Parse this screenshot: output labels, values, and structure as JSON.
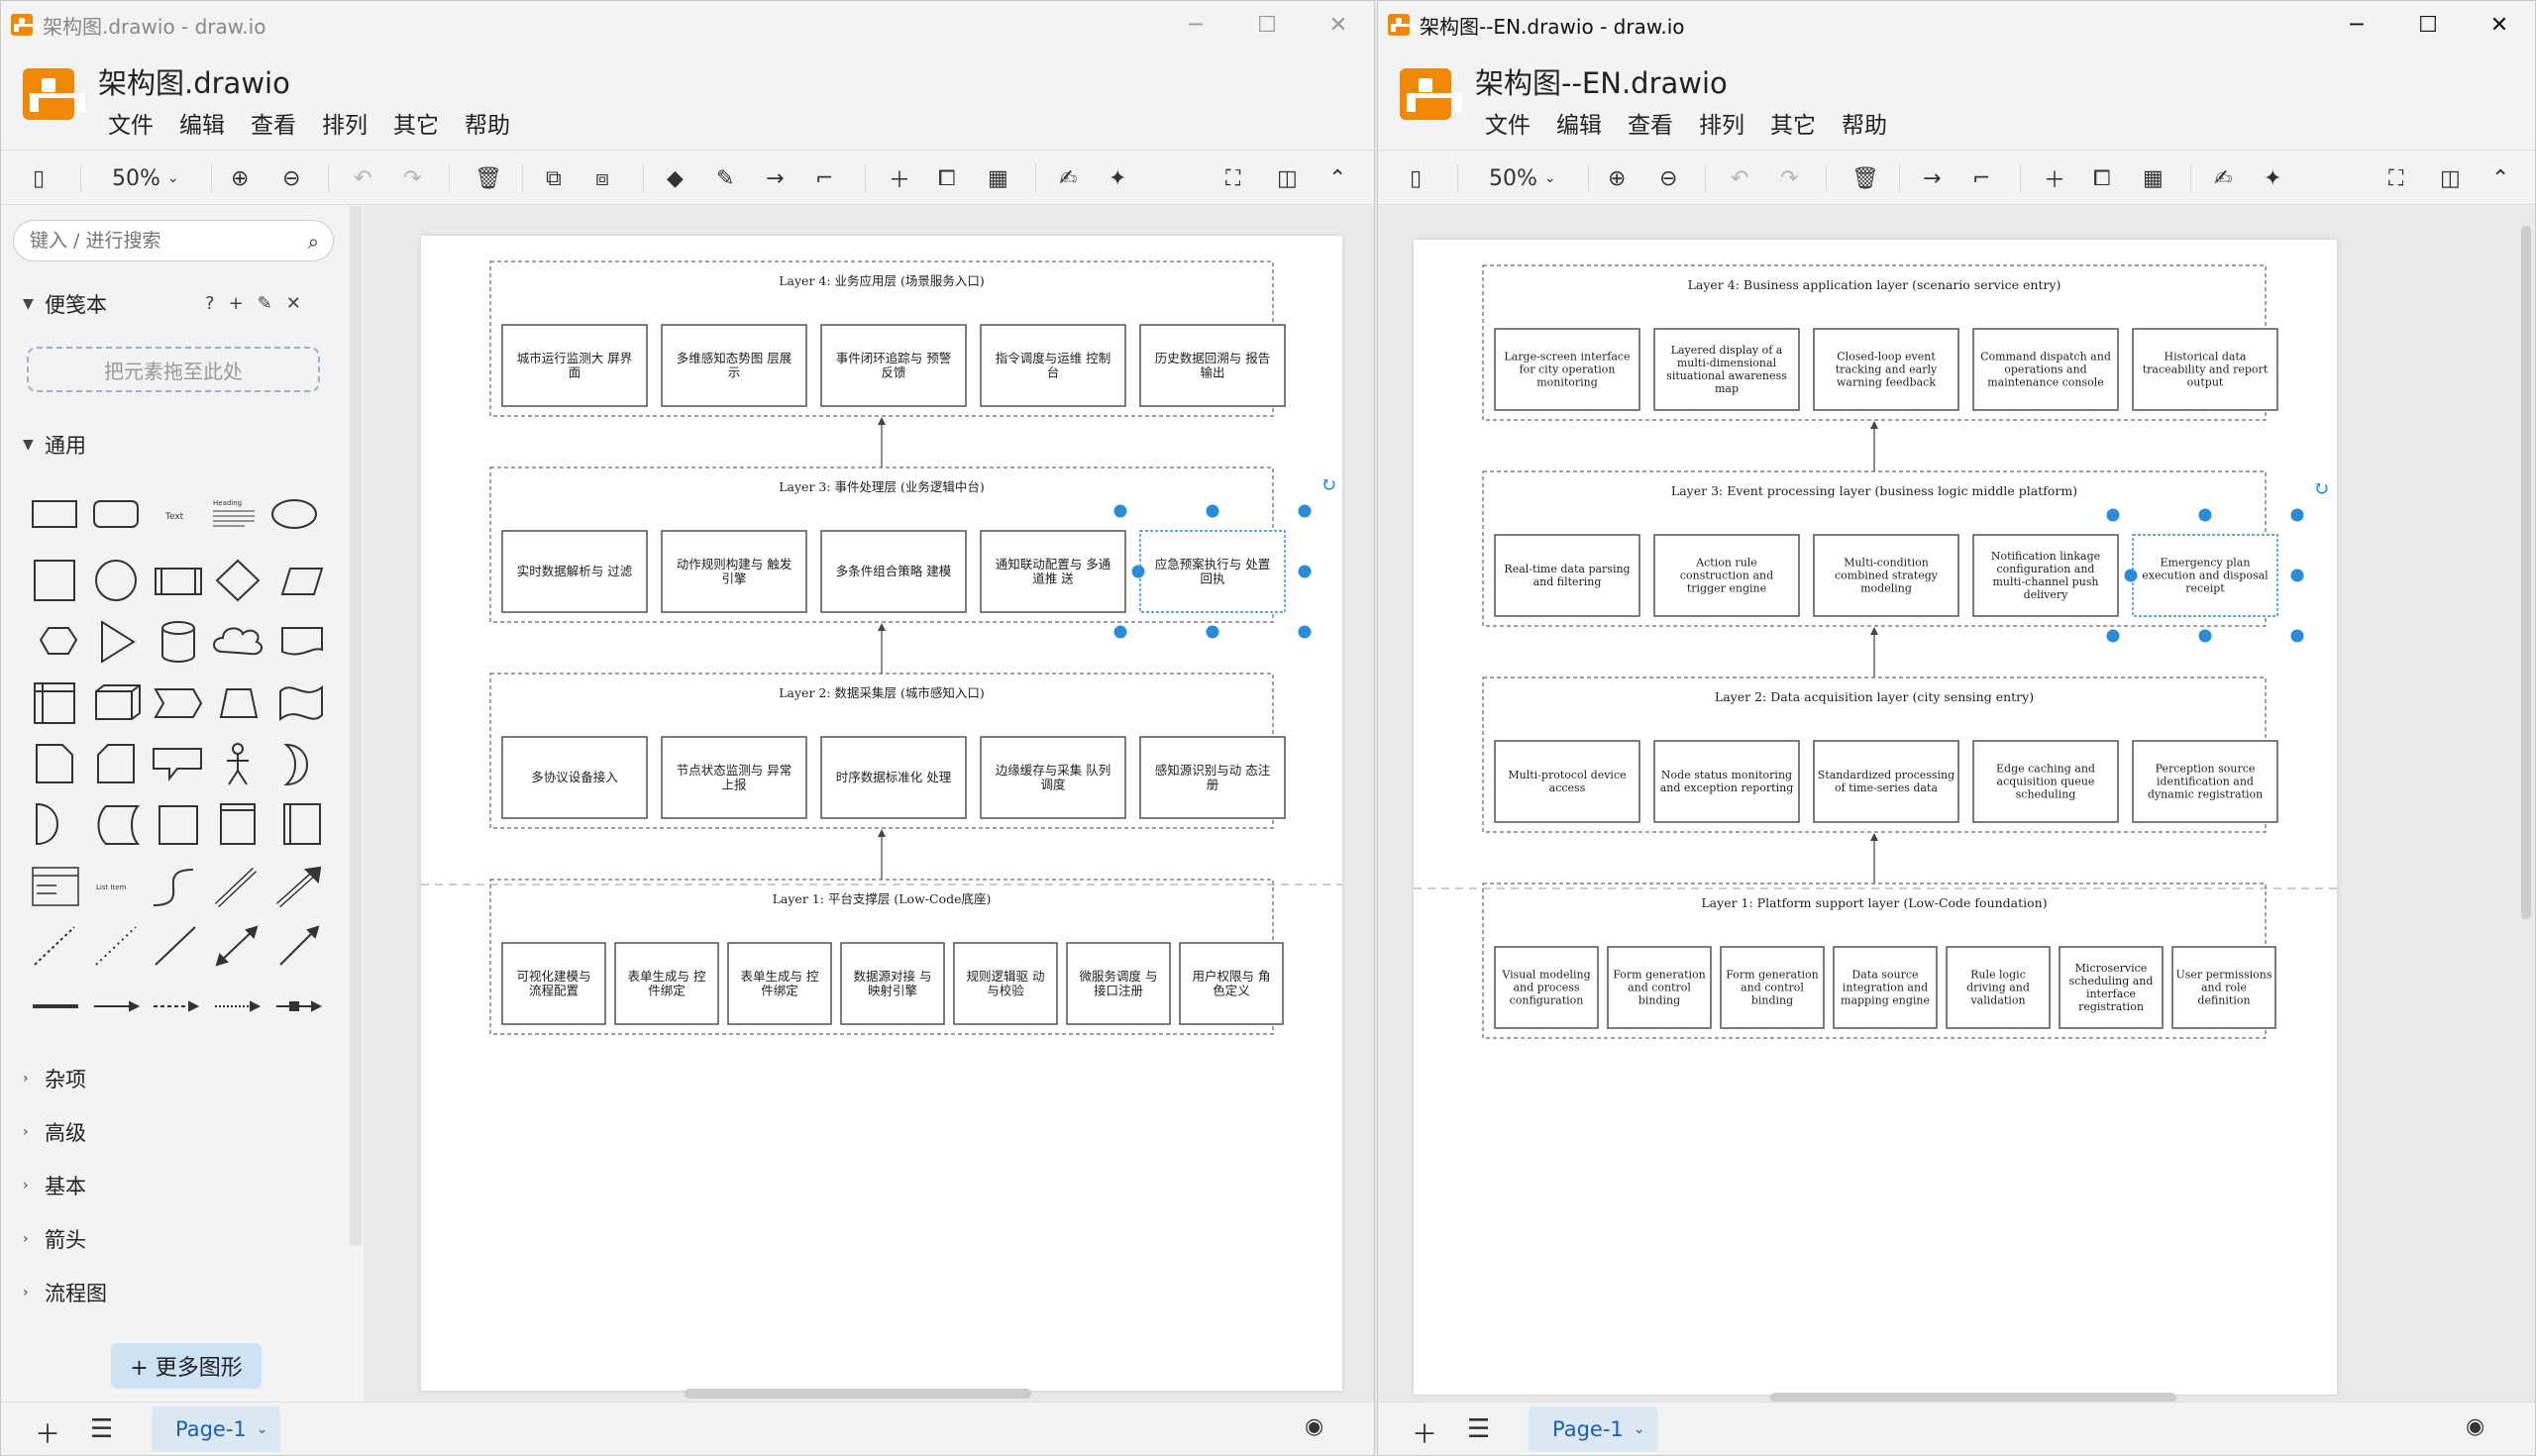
{
  "left": {
    "window_title": "架构图.drawio - draw.io",
    "doc_title": "架构图.drawio",
    "menu": [
      "文件",
      "编辑",
      "查看",
      "排列",
      "其它",
      "帮助"
    ],
    "zoom": "50%",
    "search_placeholder": "键入 / 进行搜索",
    "scratchpad": "便笺本",
    "dropzone": "把元素拖至此处",
    "general": "通用",
    "shape_texts": {
      "text": "Text",
      "heading": "Heading",
      "list_item": "List Item"
    },
    "categories": [
      "杂项",
      "高级",
      "基本",
      "箭头",
      "流程图"
    ],
    "more_shapes": "+ 更多图形",
    "page_tab": "Page-1",
    "diagram": {
      "layers": [
        {
          "title": "Layer 4: 业务应用层 (场景服务入口)",
          "boxes": [
            "城市运行监测大 屏界面",
            "多维感知态势图 层展示",
            "事件闭环追踪与 预警反馈",
            "指令调度与运维 控制台",
            "历史数据回溯与 报告输出"
          ]
        },
        {
          "title": "Layer 3: 事件处理层 (业务逻辑中台)",
          "boxes": [
            "实时数据解析与 过滤",
            "动作规则构建与 触发引擎",
            "多条件组合策略 建模",
            "通知联动配置与 多通道推 送",
            "应急预案执行与 处置回执"
          ]
        },
        {
          "title": "Layer 2: 数据采集层 (城市感知入口)",
          "boxes": [
            "多协议设备接入",
            "节点状态监测与 异常上报",
            "时序数据标准化 处理",
            "边缘缓存与采集 队列调度",
            "感知源识别与动 态注册"
          ]
        },
        {
          "title": "Layer 1: 平台支撑层 (Low-Code底座)",
          "boxes": [
            "可视化建模与 流程配置",
            "表单生成与 控件绑定",
            "表单生成与 控件绑定",
            "数据源对接 与映射引擎",
            "规则逻辑驱 动与校验",
            "微服务调度 与接口注册",
            "用户权限与 角色定义"
          ]
        }
      ]
    }
  },
  "right": {
    "window_title": "架构图--EN.drawio - draw.io",
    "doc_title": "架构图--EN.drawio",
    "menu": [
      "文件",
      "编辑",
      "查看",
      "排列",
      "其它",
      "帮助"
    ],
    "zoom": "50%",
    "page_tab": "Page-1",
    "diagram": {
      "layers": [
        {
          "title": "Layer 4: Business application layer (scenario service entry)",
          "boxes": [
            "Large-screen interface for city operation monitoring",
            "Layered display of a multi-dimensional situational awareness map",
            "Closed-loop event tracking and early warning feedback",
            "Command dispatch and operations and maintenance console",
            "Historical data traceability and report output"
          ]
        },
        {
          "title": "Layer 3: Event processing layer (business logic middle platform)",
          "boxes": [
            "Real-time data parsing and filtering",
            "Action rule construction and trigger engine",
            "Multi-condition combined strategy modeling",
            "Notification linkage configuration and multi-channel push delivery",
            "Emergency plan execution and disposal receipt"
          ]
        },
        {
          "title": "Layer 2: Data acquisition layer (city sensing entry)",
          "boxes": [
            "Multi-protocol device access",
            "Node status monitoring and exception reporting",
            "Standardized processing of time-series data",
            "Edge caching and acquisition queue scheduling",
            "Perception source identification and dynamic registration"
          ]
        },
        {
          "title": "Layer 1: Platform support layer (Low-Code foundation)",
          "boxes": [
            "Visual modeling and process configuration",
            "Form generation and control binding",
            "Form generation and control binding",
            "Data source integration and mapping engine",
            "Rule logic driving and validation",
            "Microservice scheduling and interface registration",
            "User permissions and role definition"
          ]
        }
      ]
    }
  }
}
